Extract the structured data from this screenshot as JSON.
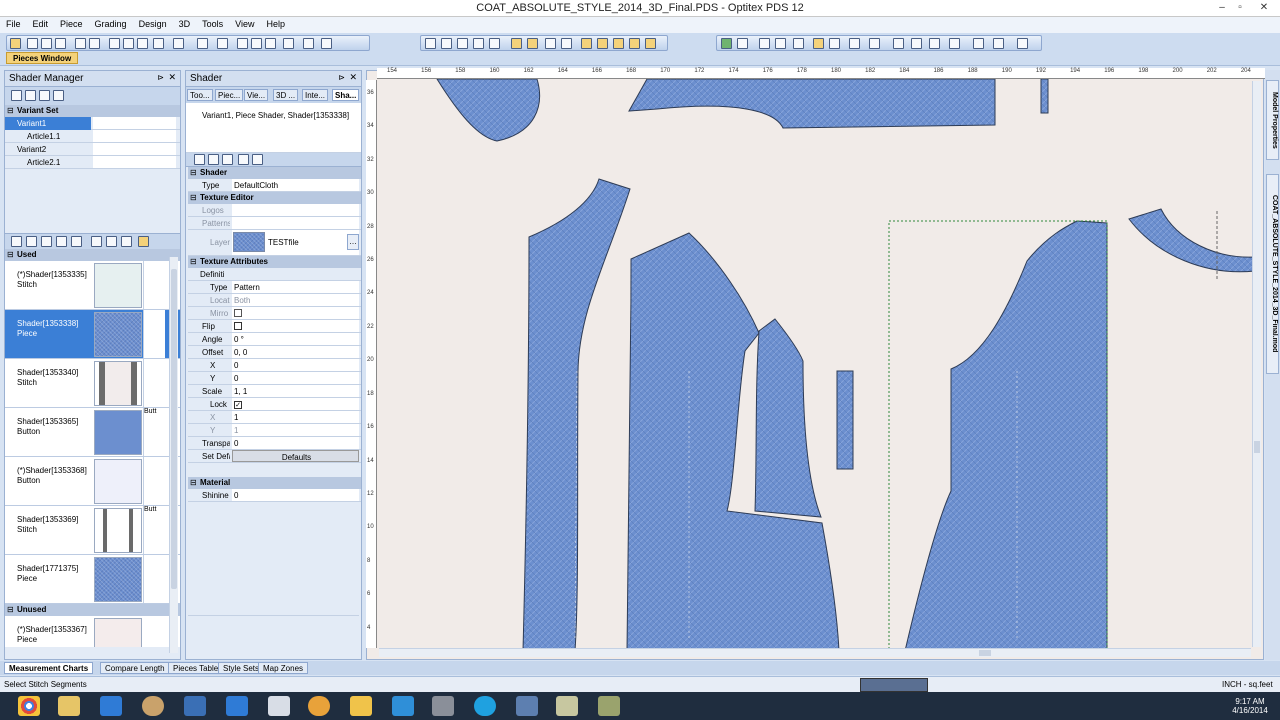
{
  "window": {
    "title": "COAT_ABSOLUTE_STYLE_2014_3D_Final.PDS - Optitex PDS 12"
  },
  "menu": [
    "File",
    "Edit",
    "Piece",
    "Grading",
    "Design",
    "3D",
    "Tools",
    "View",
    "Help"
  ],
  "toolbar": {
    "pieces_window": "Pieces Window"
  },
  "shader_manager": {
    "title": "Shader Manager",
    "variant_set_label": "Variant Set",
    "variants": [
      {
        "name": "Variant1",
        "article": "Article1.1"
      },
      {
        "name": "Variant2",
        "article": "Article2.1"
      }
    ],
    "used_label": "Used",
    "used": [
      {
        "id": "(*)Shader[1353335]",
        "type": "Stitch",
        "extra": ""
      },
      {
        "id": "Shader[1353338]",
        "type": "Piece",
        "extra": ""
      },
      {
        "id": "Shader[1353340]",
        "type": "Stitch",
        "extra": ""
      },
      {
        "id": "Shader[1353365]",
        "type": "Button",
        "extra": "Butt"
      },
      {
        "id": "(*)Shader[1353368]",
        "type": "Button",
        "extra": ""
      },
      {
        "id": "Shader[1353369]",
        "type": "Stitch",
        "extra": "Butt"
      },
      {
        "id": "Shader[1771375]",
        "type": "Piece",
        "extra": ""
      }
    ],
    "unused_label": "Unused",
    "unused": [
      {
        "id": "(*)Shader[1353367]",
        "type": "Piece"
      }
    ]
  },
  "shader_panel": {
    "title": "Shader",
    "tabs": [
      "Too...",
      "Piec...",
      "Vie...",
      "3D ...",
      "Inte...",
      "Sha..."
    ],
    "caption": "Variant1, Piece Shader, Shader[1353338]",
    "shader_group": "Shader",
    "type_label": "Type",
    "type_value": "DefaultCloth",
    "texture_editor": "Texture Editor",
    "logos_label": "Logos",
    "patterns_label": "Patterns",
    "layer_label": "Layer",
    "layer_value": "TESTfile",
    "texture_attributes": "Texture Attributes",
    "definition_label": "Definiti",
    "attr_type_label": "Type",
    "attr_type_value": "Pattern",
    "location_label": "Locat",
    "location_value": "Both",
    "mirror_label": "Mirro",
    "flip_label": "Flip",
    "angle_label": "Angle",
    "angle_value": "0 °",
    "offset_label": "Offset",
    "offset_value": "0, 0",
    "x_label": "X",
    "x_value": "0",
    "y_label": "Y",
    "y_value": "0",
    "scale_label": "Scale",
    "scale_value": "1, 1",
    "lock_label": "Lock",
    "sx_label": "X",
    "sx_value": "1",
    "sy_label": "Y",
    "sy_value": "1",
    "transparency_label": "Transpa",
    "transparency_value": "0",
    "set_default_label": "Set Defa",
    "defaults_button": "Defaults",
    "material": "Material",
    "shininess_label": "Shinine",
    "shininess_value": "0"
  },
  "ruler": {
    "top": [
      "154",
      "156",
      "158",
      "160",
      "162",
      "164",
      "166",
      "168",
      "170",
      "172",
      "174",
      "176",
      "178",
      "180",
      "182",
      "184",
      "186",
      "188",
      "190",
      "192",
      "194",
      "196",
      "198",
      "200",
      "202",
      "204"
    ],
    "left": [
      "36",
      "34",
      "32",
      "30",
      "28",
      "26",
      "24",
      "22",
      "20",
      "18",
      "16",
      "14",
      "12",
      "10",
      "8",
      "6",
      "4"
    ]
  },
  "right_tabs": [
    "Model Properties",
    "COAT_ABSOLUTE_STYLE_2014_3D_Final.mod"
  ],
  "bottom_tabs": [
    "Measurement Charts",
    "Compare Length",
    "Pieces Table",
    "Style Sets",
    "Map Zones"
  ],
  "status": {
    "left": "Select Stitch Segments",
    "units": "INCH - sq.feet"
  },
  "clock": {
    "time": "9:17 AM",
    "date": "4/16/2014"
  },
  "colors": {
    "denim": "#6c8fcf",
    "canvas": "#f1ebe8",
    "selection": "#2f8a3a"
  }
}
